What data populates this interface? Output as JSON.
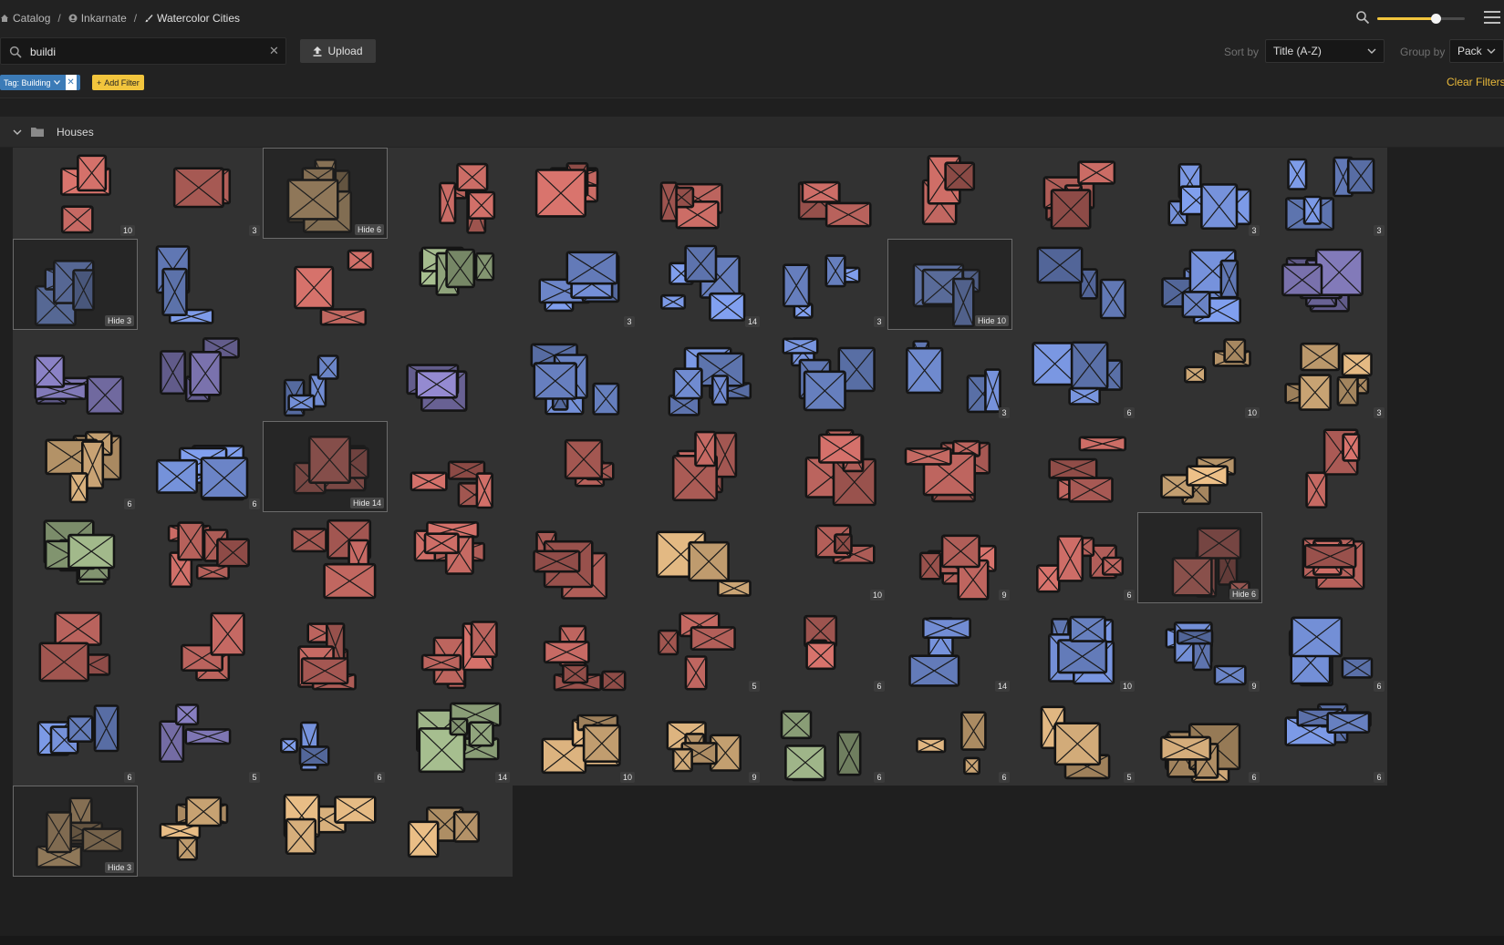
{
  "breadcrumbs": [
    {
      "label": "Catalog",
      "icon": "home-icon"
    },
    {
      "label": "Inkarnate",
      "icon": "user-circle-icon"
    },
    {
      "label": "Watercolor Cities",
      "icon": "brush-icon"
    }
  ],
  "zoom": {
    "level": 0.67
  },
  "search": {
    "value": "buildi",
    "placeholder": ""
  },
  "upload_label": "Upload",
  "sort": {
    "label": "Sort by",
    "value": "Title (A-Z)"
  },
  "group": {
    "label": "Group by",
    "value": "Pack"
  },
  "filters": {
    "tag_label": "Tag: Building",
    "add_label": "Add Filter",
    "clear_label": "Clear Filters"
  },
  "group_title": "Houses",
  "colors": {
    "accent": "#f2c53d",
    "tag": "#3c7bb7",
    "red": "#b8625c",
    "blue": "#6c86c9",
    "green": "#8fa37b",
    "tan": "#c6a172",
    "purple": "#7c74b0"
  },
  "assets": [
    {
      "color": "red",
      "badge": "10"
    },
    {
      "color": "red",
      "badge": "3"
    },
    {
      "color": "tan",
      "badge": "Hide 6",
      "selected": true
    },
    {
      "color": "red",
      "badge": ""
    },
    {
      "color": "red",
      "badge": ""
    },
    {
      "color": "red",
      "badge": ""
    },
    {
      "color": "red",
      "badge": ""
    },
    {
      "color": "red",
      "badge": ""
    },
    {
      "color": "red",
      "badge": ""
    },
    {
      "color": "blue",
      "badge": "3"
    },
    {
      "color": "blue",
      "badge": "3"
    },
    {
      "color": "blue",
      "badge": "Hide 3",
      "selected": true
    },
    {
      "color": "blue",
      "badge": ""
    },
    {
      "color": "red",
      "badge": ""
    },
    {
      "color": "green",
      "badge": ""
    },
    {
      "color": "blue",
      "badge": "3"
    },
    {
      "color": "blue",
      "badge": "14"
    },
    {
      "color": "blue",
      "badge": "3"
    },
    {
      "color": "blue",
      "badge": "Hide 10",
      "selected": true
    },
    {
      "color": "blue",
      "badge": ""
    },
    {
      "color": "blue",
      "badge": ""
    },
    {
      "color": "purple",
      "badge": ""
    },
    {
      "color": "purple",
      "badge": ""
    },
    {
      "color": "purple",
      "badge": ""
    },
    {
      "color": "blue",
      "badge": ""
    },
    {
      "color": "purple",
      "badge": ""
    },
    {
      "color": "blue",
      "badge": ""
    },
    {
      "color": "blue",
      "badge": ""
    },
    {
      "color": "blue",
      "badge": ""
    },
    {
      "color": "blue",
      "badge": "3"
    },
    {
      "color": "blue",
      "badge": "6"
    },
    {
      "color": "tan",
      "badge": "10"
    },
    {
      "color": "tan",
      "badge": "3"
    },
    {
      "color": "tan",
      "badge": "6"
    },
    {
      "color": "blue",
      "badge": "6"
    },
    {
      "color": "red",
      "badge": "Hide 14",
      "selected": true
    },
    {
      "color": "red",
      "badge": ""
    },
    {
      "color": "red",
      "badge": ""
    },
    {
      "color": "red",
      "badge": ""
    },
    {
      "color": "red",
      "badge": ""
    },
    {
      "color": "red",
      "badge": ""
    },
    {
      "color": "red",
      "badge": ""
    },
    {
      "color": "tan",
      "badge": ""
    },
    {
      "color": "red",
      "badge": ""
    },
    {
      "color": "green",
      "badge": ""
    },
    {
      "color": "red",
      "badge": ""
    },
    {
      "color": "red",
      "badge": ""
    },
    {
      "color": "red",
      "badge": ""
    },
    {
      "color": "red",
      "badge": ""
    },
    {
      "color": "tan",
      "badge": ""
    },
    {
      "color": "red",
      "badge": "10"
    },
    {
      "color": "red",
      "badge": "9"
    },
    {
      "color": "red",
      "badge": "6"
    },
    {
      "color": "red",
      "badge": "Hide 6",
      "selected": true
    },
    {
      "color": "red",
      "badge": ""
    },
    {
      "color": "red",
      "badge": ""
    },
    {
      "color": "red",
      "badge": ""
    },
    {
      "color": "red",
      "badge": ""
    },
    {
      "color": "red",
      "badge": ""
    },
    {
      "color": "red",
      "badge": ""
    },
    {
      "color": "red",
      "badge": "5"
    },
    {
      "color": "red",
      "badge": "6"
    },
    {
      "color": "blue",
      "badge": "14"
    },
    {
      "color": "blue",
      "badge": "10"
    },
    {
      "color": "blue",
      "badge": "9"
    },
    {
      "color": "blue",
      "badge": "6"
    },
    {
      "color": "blue",
      "badge": "6"
    },
    {
      "color": "purple",
      "badge": "5"
    },
    {
      "color": "blue",
      "badge": "6"
    },
    {
      "color": "green",
      "badge": "14"
    },
    {
      "color": "tan",
      "badge": "10"
    },
    {
      "color": "tan",
      "badge": "9"
    },
    {
      "color": "green",
      "badge": "6"
    },
    {
      "color": "tan",
      "badge": "6"
    },
    {
      "color": "tan",
      "badge": "5"
    },
    {
      "color": "tan",
      "badge": "6"
    },
    {
      "color": "blue",
      "badge": "6"
    },
    {
      "color": "tan",
      "badge": "Hide 3",
      "selected": true
    },
    {
      "color": "tan",
      "badge": ""
    },
    {
      "color": "tan",
      "badge": ""
    },
    {
      "color": "tan",
      "badge": ""
    }
  ]
}
